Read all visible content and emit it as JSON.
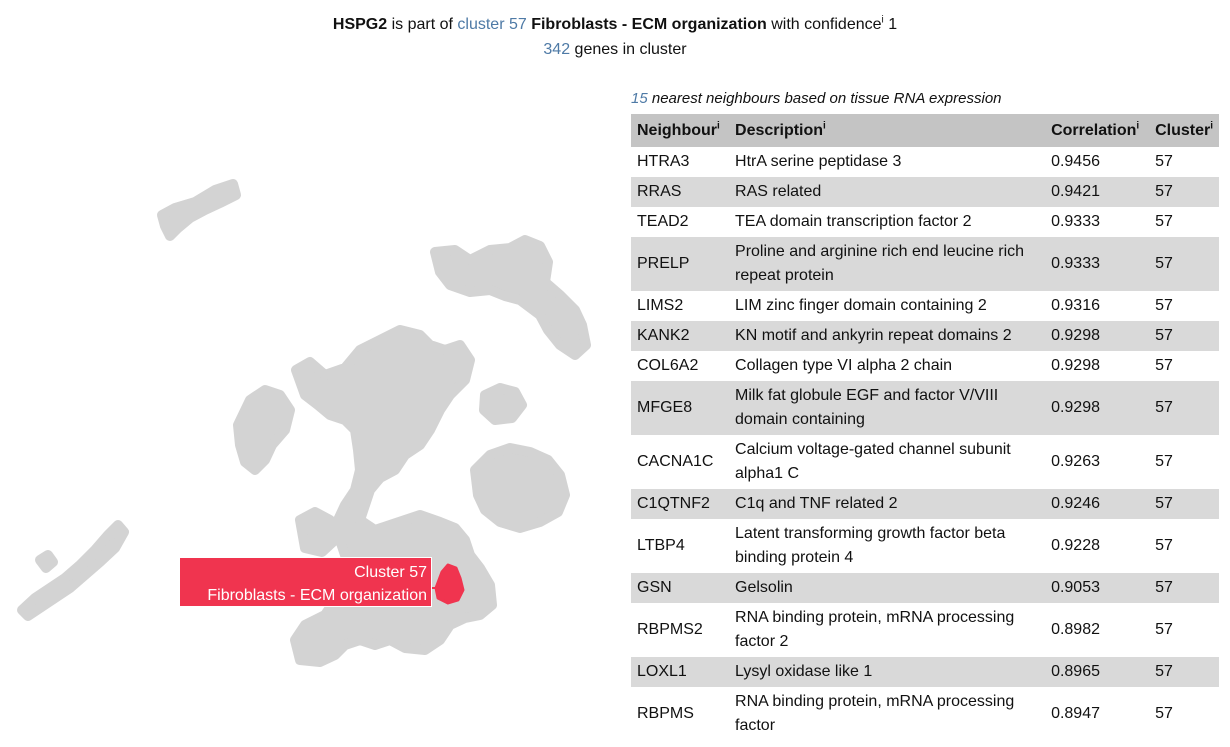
{
  "header": {
    "gene": "HSPG2",
    "text_part_of": " is part of ",
    "cluster_link": "cluster 57",
    "cluster_name": " Fibroblasts - ECM organization",
    "text_confidence": " with confidence",
    "info_mark": "i",
    "confidence_value": " 1",
    "gene_count": "342",
    "gene_count_suffix": " genes in cluster"
  },
  "map": {
    "highlight_color": "#f0344f",
    "base_color": "#d3d3d3",
    "label_line1": "Cluster 57",
    "label_line2": "Fibroblasts - ECM organization"
  },
  "neighbours": {
    "count": "15",
    "title_suffix": " nearest neighbours based on tissue RNA expression",
    "columns": [
      "Neighbour",
      "Description",
      "Correlation",
      "Cluster"
    ],
    "info_mark": "i",
    "rows": [
      {
        "gene": "HTRA3",
        "desc": "HtrA serine peptidase 3",
        "corr": "0.9456",
        "cluster": "57"
      },
      {
        "gene": "RRAS",
        "desc": "RAS related",
        "corr": "0.9421",
        "cluster": "57"
      },
      {
        "gene": "TEAD2",
        "desc": "TEA domain transcription factor 2",
        "corr": "0.9333",
        "cluster": "57"
      },
      {
        "gene": "PRELP",
        "desc": "Proline and arginine rich end leucine rich repeat protein",
        "corr": "0.9333",
        "cluster": "57"
      },
      {
        "gene": "LIMS2",
        "desc": "LIM zinc finger domain containing 2",
        "corr": "0.9316",
        "cluster": "57"
      },
      {
        "gene": "KANK2",
        "desc": "KN motif and ankyrin repeat domains 2",
        "corr": "0.9298",
        "cluster": "57"
      },
      {
        "gene": "COL6A2",
        "desc": "Collagen type VI alpha 2 chain",
        "corr": "0.9298",
        "cluster": "57"
      },
      {
        "gene": "MFGE8",
        "desc": "Milk fat globule EGF and factor V/VIII domain containing",
        "corr": "0.9298",
        "cluster": "57"
      },
      {
        "gene": "CACNA1C",
        "desc": "Calcium voltage-gated channel subunit alpha1 C",
        "corr": "0.9263",
        "cluster": "57"
      },
      {
        "gene": "C1QTNF2",
        "desc": "C1q and TNF related 2",
        "corr": "0.9246",
        "cluster": "57"
      },
      {
        "gene": "LTBP4",
        "desc": "Latent transforming growth factor beta binding protein 4",
        "corr": "0.9228",
        "cluster": "57"
      },
      {
        "gene": "GSN",
        "desc": "Gelsolin",
        "corr": "0.9053",
        "cluster": "57"
      },
      {
        "gene": "RBPMS2",
        "desc": "RNA binding protein, mRNA processing factor 2",
        "corr": "0.8982",
        "cluster": "57"
      },
      {
        "gene": "LOXL1",
        "desc": "Lysyl oxidase like 1",
        "corr": "0.8965",
        "cluster": "57"
      },
      {
        "gene": "RBPMS",
        "desc": "RNA binding protein, mRNA processing factor",
        "corr": "0.8947",
        "cluster": "57"
      }
    ]
  }
}
